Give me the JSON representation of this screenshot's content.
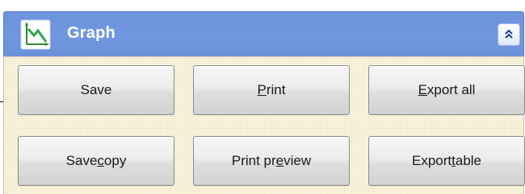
{
  "panel": {
    "title": "Graph",
    "icon": "graph-icon",
    "collapse_icon": "double-chevron-up-icon"
  },
  "colors": {
    "header": "#6d93dc",
    "body_background": "#fbf6e4",
    "button_face": "#e6e6e6"
  },
  "buttons": [
    {
      "label_pre": "Save",
      "label_mn": "",
      "label_post": ""
    },
    {
      "label_pre": "",
      "label_mn": "P",
      "label_post": "rint"
    },
    {
      "label_pre": "",
      "label_mn": "E",
      "label_post": "xport all"
    },
    {
      "label_pre": "Save ",
      "label_mn": "c",
      "label_post": "opy"
    },
    {
      "label_pre": "Print pr",
      "label_mn": "e",
      "label_post": "view"
    },
    {
      "label_pre": "Export ",
      "label_mn": "t",
      "label_post": "able"
    }
  ]
}
